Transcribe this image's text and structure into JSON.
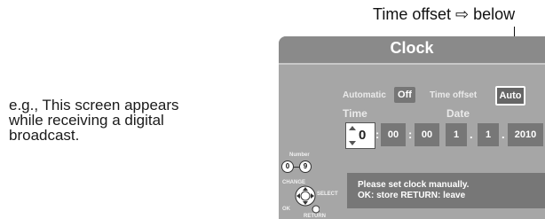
{
  "caption": {
    "lines": [
      "e.g., This screen appears",
      "while receiving a digital",
      "broadcast."
    ]
  },
  "callout": {
    "text": "Time offset ⇨ below"
  },
  "dialog": {
    "title": "Clock",
    "automatic_label": "Automatic",
    "automatic_value": "Off",
    "time_offset_label": "Time offset",
    "time_offset_value": "Auto",
    "time_label": "Time",
    "time": {
      "hour": "0",
      "minute": "00",
      "second": "00"
    },
    "date_label": "Date",
    "date": {
      "day": "1",
      "month": "1",
      "year": "2010"
    },
    "message_line1": "Please set clock manually.",
    "message_line2": "OK: store    RETURN: leave"
  },
  "remote_legend": {
    "number_label": "Number",
    "key_start": "0",
    "key_end": "9",
    "change_label": "CHANGE",
    "select_label": "SELECT",
    "ok_label": "OK",
    "return_label": "RETURN"
  },
  "colors": {
    "screen_bg": "#a6a6a6",
    "titlebar_bg": "#8a8a8a",
    "chip_bg": "#777777",
    "highlight_border": "#ffffff"
  },
  "icons": [
    "up-down-arrow-icon",
    "dpad-icon",
    "return-button-icon"
  ]
}
